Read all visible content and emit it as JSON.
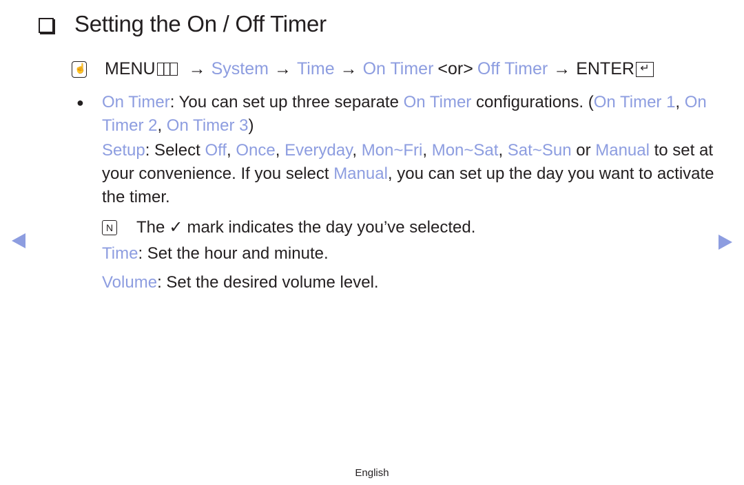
{
  "title": "Setting the On / Off Timer",
  "path": {
    "menu": "MENU",
    "arrow": "→",
    "system": "System",
    "time": "Time",
    "on_timer": "On Timer",
    "or": "<or>",
    "off_timer": "Off Timer",
    "enter": "ENTER",
    "enter_glyph": "↵"
  },
  "para1": {
    "term": "On Timer",
    "text1": ": You can set up three separate ",
    "term2": "On Timer",
    "text2": " configurations. (",
    "t1": "On Timer 1",
    "sep1": ", ",
    "t2": "On Timer 2",
    "sep2": ", ",
    "t3": "On Timer 3",
    "close": ")"
  },
  "setup": {
    "term": "Setup",
    "text1": ": Select ",
    "opts": [
      "Off",
      "Once",
      "Everyday",
      "Mon~Fri",
      "Mon~Sat",
      "Sat~Sun"
    ],
    "comma": ", ",
    "or": " or ",
    "manual": "Manual",
    "text2": " to set at your convenience. If you select ",
    "manual2": "Manual",
    "text3": ", you can set up the day you want to activate the timer."
  },
  "note": {
    "icon": "N",
    "text1": "The",
    "check": "✓",
    "text2": "mark indicates the day you’ve selected."
  },
  "time_item": {
    "term": "Time",
    "text": ": Set the hour and minute."
  },
  "volume_item": {
    "term": "Volume",
    "text": ": Set the desired volume level."
  },
  "bullet": "●",
  "footer": "English",
  "colors": {
    "highlight": "#8d9de0",
    "text": "#231f20"
  }
}
